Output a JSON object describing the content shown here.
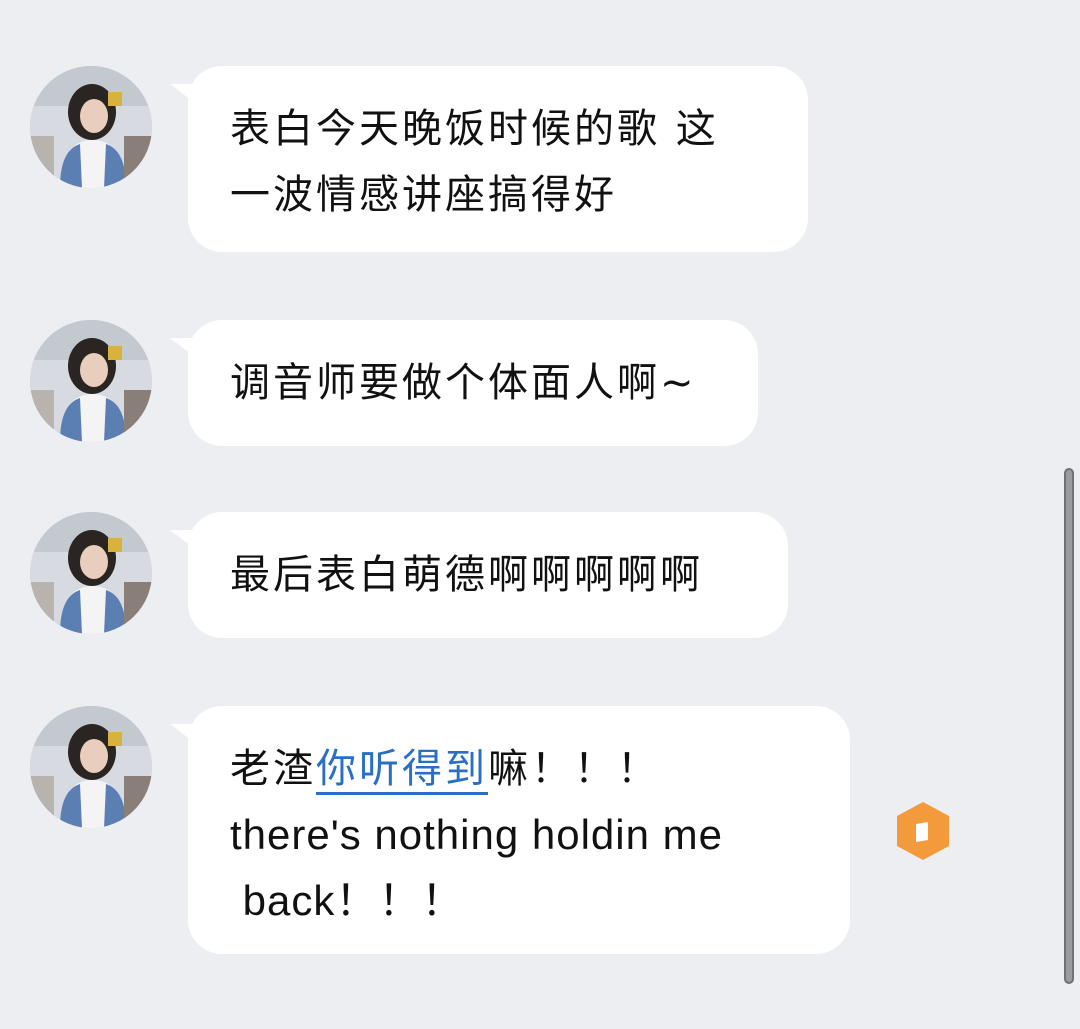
{
  "messages": [
    {
      "lines": [
        "表白今天晚饭时候的歌 这",
        "一波情感讲座搞得好"
      ]
    },
    {
      "lines": [
        "调音师要做个体面人啊~"
      ]
    },
    {
      "lines": [
        "最后表白萌德啊啊啊啊啊"
      ]
    },
    {
      "prefix": "老渣",
      "link": "你听得到",
      "suffix": "嘛！！！",
      "line2": "there's nothing holdin me",
      "line3": " back！！！"
    }
  ],
  "colors": {
    "background": "#eceef2",
    "bubble": "#ffffff",
    "link": "#2a6fc4",
    "badge": "#f39a3c"
  },
  "icons": {
    "avatar": "user-avatar",
    "badge": "hexagon-badge-icon"
  }
}
